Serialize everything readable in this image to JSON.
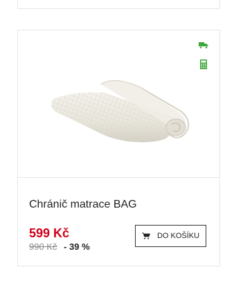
{
  "product": {
    "title": "Chránič matrace BAG",
    "price": "599 Kč",
    "old_price": "990 Kč",
    "discount": "- 39 %",
    "cart_button_label": "DO KOŠÍKU"
  },
  "badges": [
    {
      "icon": "delivery-truck-icon",
      "color": "#3aa53a"
    },
    {
      "icon": "calculator-icon",
      "color": "#3aa53a"
    }
  ],
  "colors": {
    "price": "#d10019",
    "badge": "#3aa53a",
    "border": "#e6e6e6"
  }
}
